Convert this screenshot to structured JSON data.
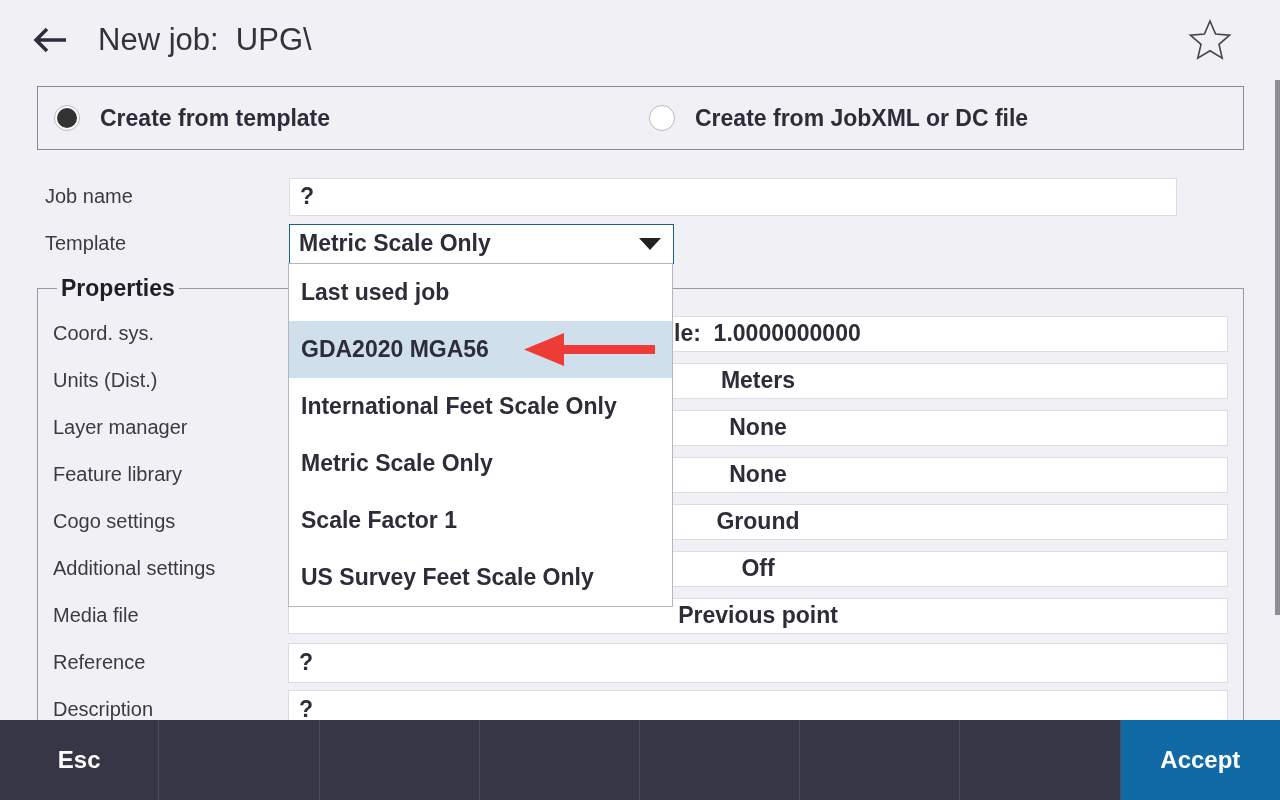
{
  "header": {
    "title": "New job:  UPG\\",
    "favorite": false
  },
  "source_options": [
    {
      "label": "Create from template",
      "selected": true
    },
    {
      "label": "Create from JobXML or DC file",
      "selected": false
    }
  ],
  "job_name": {
    "label": "Job name",
    "value": "?"
  },
  "template": {
    "label": "Template",
    "value": "Metric Scale Only",
    "expanded": true,
    "options": [
      {
        "label": "Last used job",
        "highlighted": false
      },
      {
        "label": "GDA2020 MGA56",
        "highlighted": true
      },
      {
        "label": "International Feet Scale Only",
        "highlighted": false
      },
      {
        "label": "Metric Scale Only",
        "highlighted": false
      },
      {
        "label": "Scale Factor 1",
        "highlighted": false
      },
      {
        "label": "US Survey Feet Scale Only",
        "highlighted": false
      }
    ]
  },
  "properties": {
    "title": "Properties",
    "rows": [
      {
        "label": "Coord. sys.",
        "value": "le:  1.0000000000",
        "kind": "partial"
      },
      {
        "label": "Units (Dist.)",
        "value": "Meters",
        "kind": "button"
      },
      {
        "label": "Layer manager",
        "value": "None",
        "kind": "button"
      },
      {
        "label": "Feature library",
        "value": "None",
        "kind": "button"
      },
      {
        "label": "Cogo settings",
        "value": "Ground",
        "kind": "button"
      },
      {
        "label": "Additional settings",
        "value": "Off",
        "kind": "button"
      },
      {
        "label": "Media file",
        "value": "Previous point",
        "kind": "button"
      },
      {
        "label": "Reference",
        "value": "?",
        "kind": "input"
      },
      {
        "label": "Description",
        "value": "?",
        "kind": "input"
      }
    ]
  },
  "softkeys": {
    "left": "Esc",
    "right": "Accept"
  }
}
